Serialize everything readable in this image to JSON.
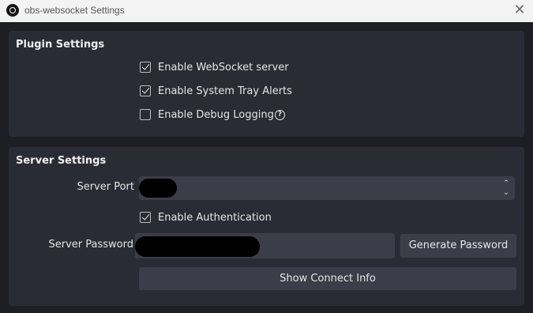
{
  "window": {
    "title": "obs-websocket Settings",
    "close_symbol": "✕",
    "app_icon": "obs-logo-icon"
  },
  "plugin_settings": {
    "title": "Plugin Settings",
    "options": [
      {
        "label": "Enable WebSocket server",
        "checked": true
      },
      {
        "label": "Enable System Tray Alerts",
        "checked": true
      },
      {
        "label": "Enable Debug Logging",
        "checked": false,
        "help_icon": "?"
      }
    ]
  },
  "server_settings": {
    "title": "Server Settings",
    "port_label": "Server Port",
    "spin_up": "⌃",
    "spin_down": "⌄",
    "auth_label": "Enable Authentication",
    "auth_checked": true,
    "password_label": "Server Password",
    "generate_button": "Generate Password",
    "connect_button": "Show Connect Info"
  },
  "colors": {
    "background": "#1e1f24",
    "panel": "#2a2c35",
    "input": "#3b3d48",
    "text": "#e6e6e6",
    "titlebar": "#f3f3f3"
  }
}
